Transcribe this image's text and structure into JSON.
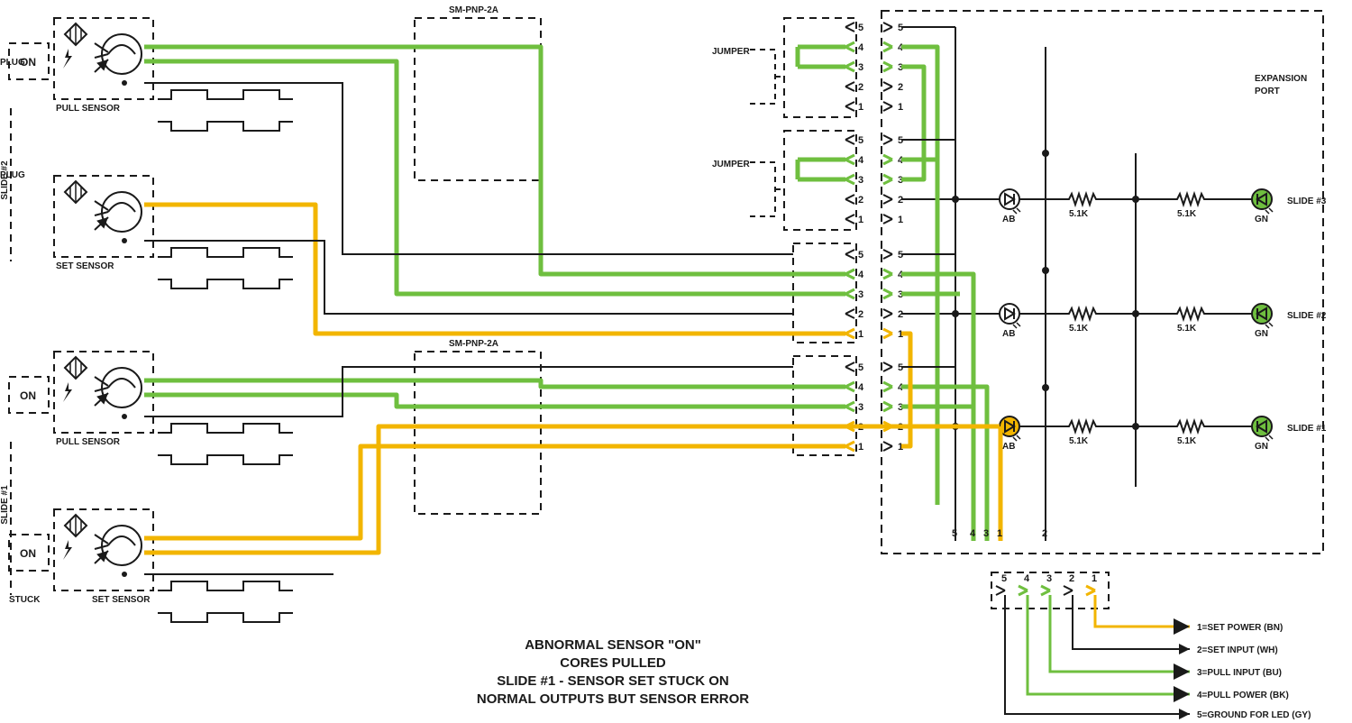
{
  "title": {
    "l1": "ABNORMAL SENSOR \"ON\"",
    "l2": "CORES PULLED",
    "l3": "SLIDE #1 - SENSOR SET STUCK ON",
    "l4": "NORMAL OUTPUTS BUT SENSOR ERROR"
  },
  "sensors": {
    "s2_pull": {
      "name": "PULL SENSOR",
      "state": "ON",
      "stuck": ""
    },
    "s2_set": {
      "name": "SET SENSOR",
      "state": "",
      "stuck": ""
    },
    "s1_pull": {
      "name": "PULL SENSOR",
      "state": "ON",
      "stuck": ""
    },
    "s1_set": {
      "name": "SET SENSOR",
      "state": "ON",
      "stuck": "STUCK"
    }
  },
  "modules": {
    "top": "SM-PNP-2A",
    "bot": "SM-PNP-2A"
  },
  "slides": {
    "left_top": "SLIDE #2",
    "left_bot": "SLIDE #1"
  },
  "jumpers": {
    "a": "JUMPER\nPLUG",
    "b": "JUMPER\nPLUG"
  },
  "expansion": "EXPANSION\nPORT",
  "rows": {
    "r1": "SLIDE #3",
    "r2": "SLIDE #2",
    "r3": "SLIDE #1"
  },
  "comp": {
    "ab": "AB",
    "r51k": "5.1K",
    "gn": "GN"
  },
  "legend": {
    "t": "",
    "p1": "1=SET POWER (BN)",
    "p2": "2=SET INPUT (WH)",
    "p3": "3=PULL INPUT (BU)",
    "p4": "4=PULL POWER (BK)",
    "p5": "5=GROUND FOR LED (GY)"
  },
  "pins": [
    "1",
    "2",
    "3",
    "4",
    "5"
  ]
}
